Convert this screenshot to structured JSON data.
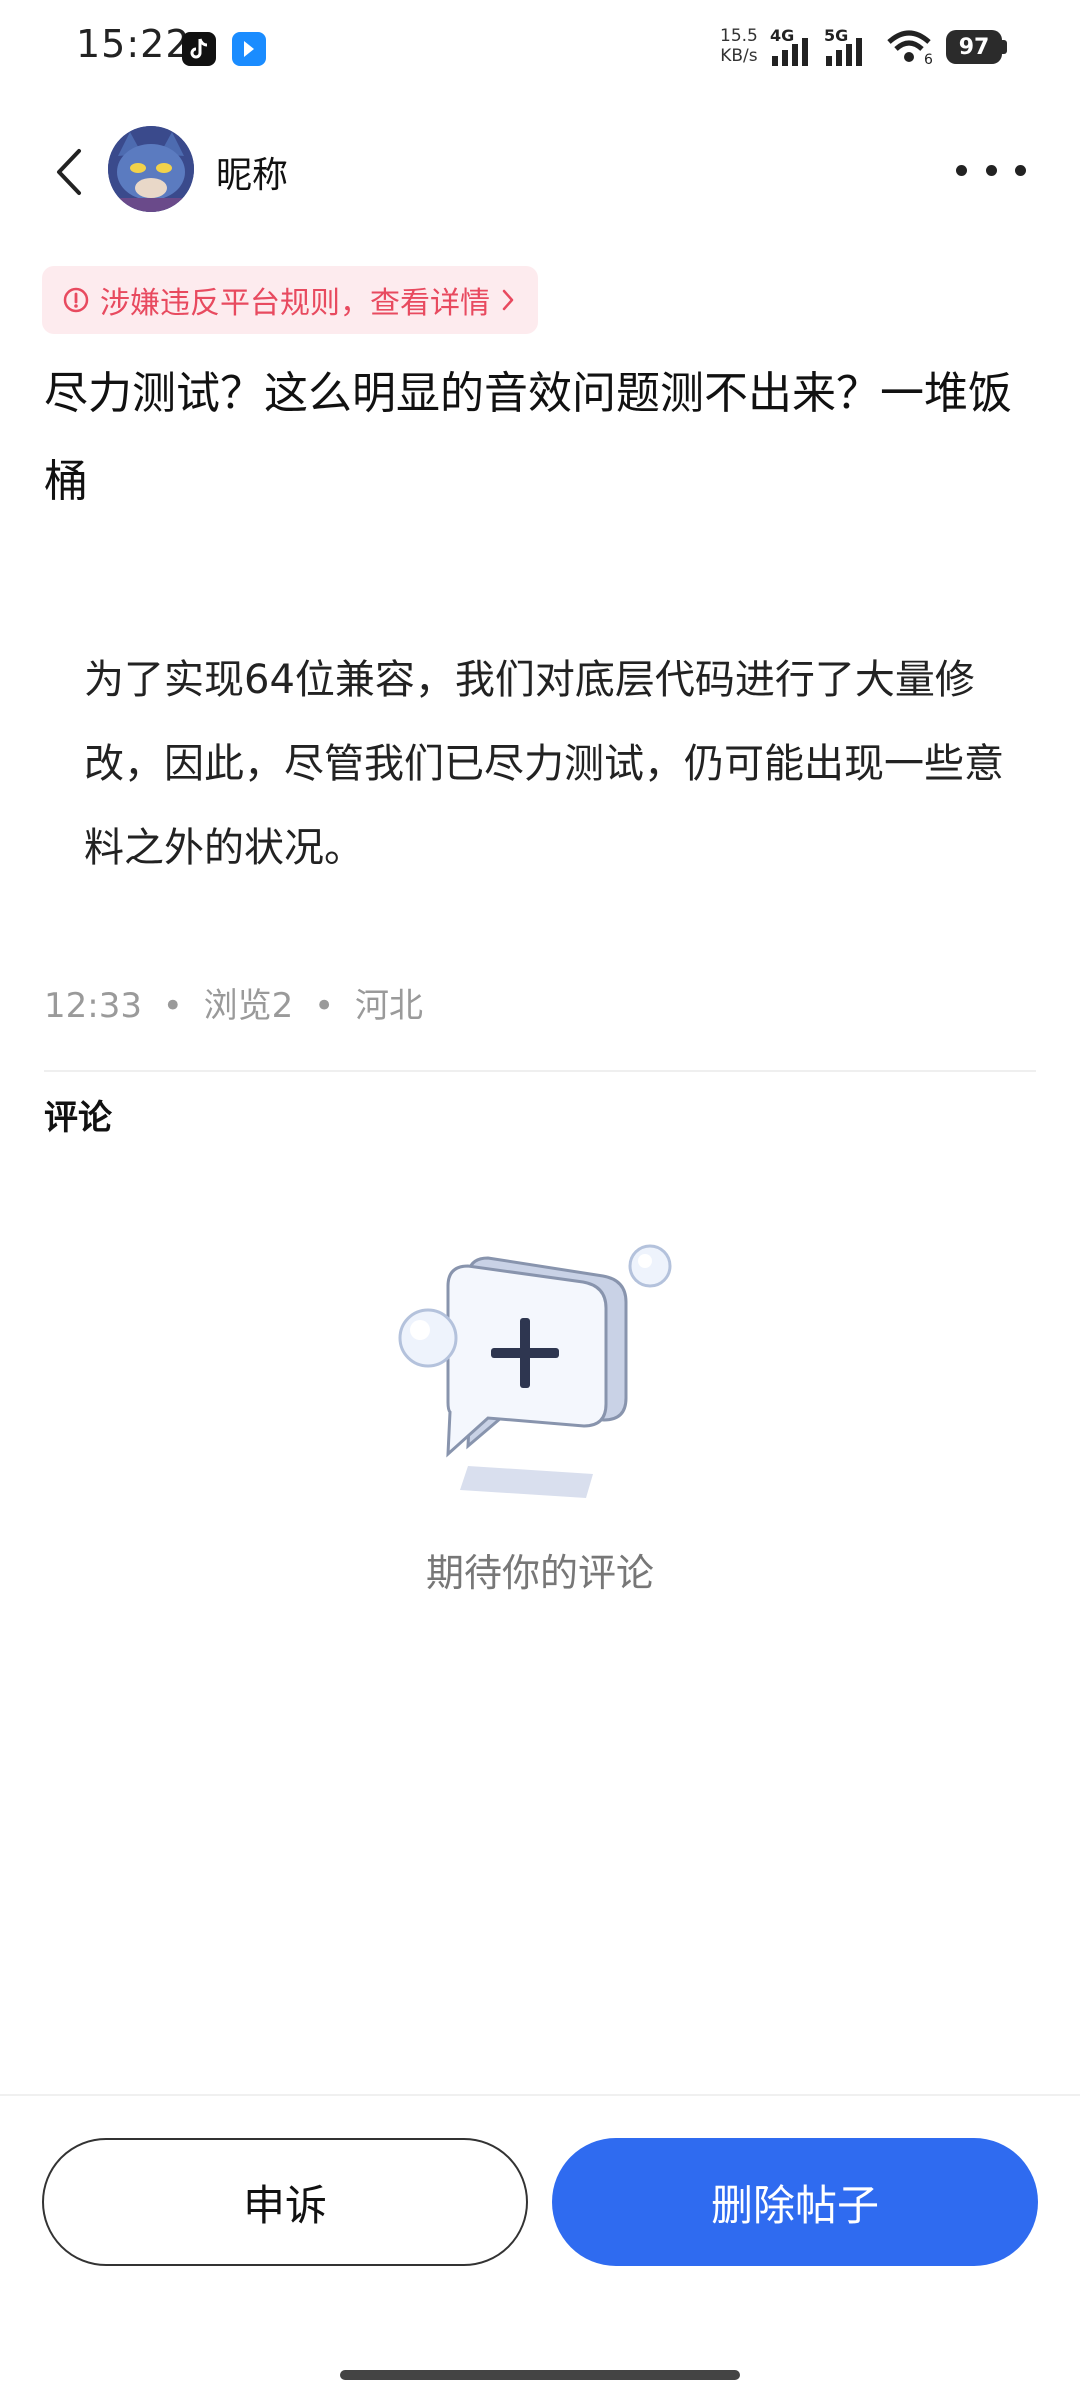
{
  "status_bar": {
    "time": "15:22",
    "net_speed_value": "15.5",
    "net_speed_unit": "KB/s",
    "signal_1_label": "4G",
    "signal_2_label": "5G",
    "wifi_label": "6",
    "battery": "97"
  },
  "header": {
    "nickname": "昵称"
  },
  "violation": {
    "text": "涉嫌违反平台规则，查看详情"
  },
  "post": {
    "title": "尽力测试？这么明显的音效问题测不出来？一堆饭桶",
    "body": "为了实现64位兼容，我们对底层代码进行了大量修改，因此，尽管我们已尽力测试，仍可能出现一些意料之外的状况。",
    "time": "12:33",
    "views": "浏览2",
    "location": "河北"
  },
  "comments": {
    "heading": "评论",
    "empty_text": "期待你的评论"
  },
  "actions": {
    "appeal_label": "申诉",
    "delete_label": "删除帖子"
  },
  "colors": {
    "primary": "#2f6bf0",
    "warning_text": "#e84a5f",
    "warning_bg": "#fdebee"
  }
}
